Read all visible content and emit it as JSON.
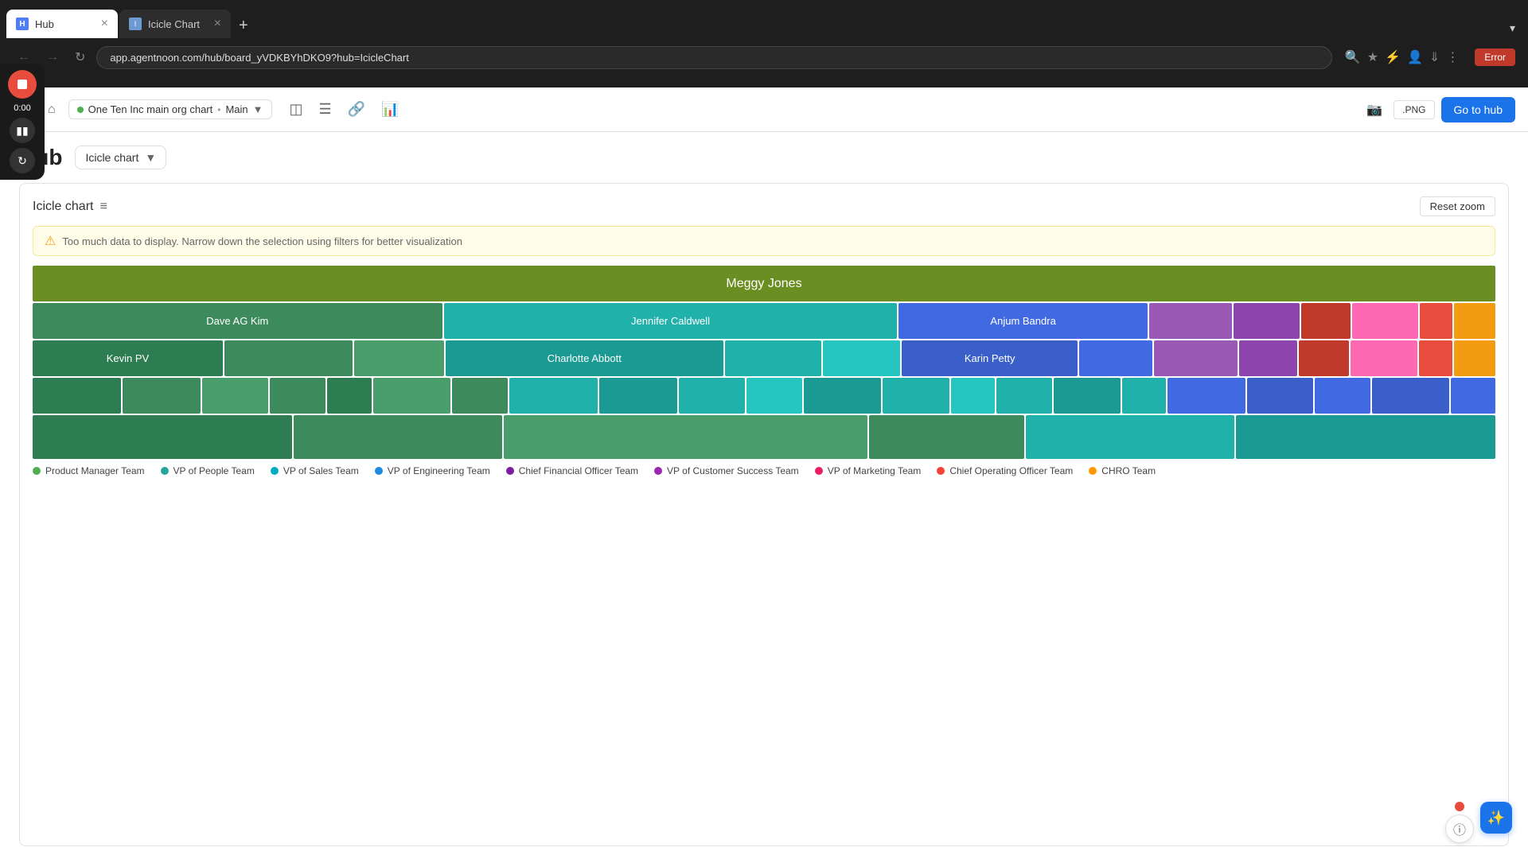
{
  "browser": {
    "tabs": [
      {
        "label": "Hub",
        "favicon_type": "hub",
        "active": true
      },
      {
        "label": "Icicle Chart",
        "favicon_type": "icicle",
        "active": false
      }
    ],
    "url": "app.agentnoon.com/hub/board_yVDKBYhDKO9?hub=IcicleChart",
    "new_tab_label": "+",
    "tab_dropdown_label": "▾",
    "error_button_label": "Error"
  },
  "toolbar": {
    "breadcrumb_org": "One Ten Inc main org chart",
    "breadcrumb_separator": "•",
    "breadcrumb_sub": "Main",
    "png_label": ".PNG",
    "go_to_hub_label": "Go to hub"
  },
  "hub": {
    "title": "Hub",
    "chart_type_label": "Icicle chart"
  },
  "chart": {
    "title": "Icicle chart",
    "warning": "Too much data to display. Narrow down the selection using filters for better visualization",
    "reset_zoom_label": "Reset zoom",
    "root_node": "Meggy Jones",
    "level2": {
      "dave": "Dave AG Kim",
      "jennifer": "Jennifer Caldwell",
      "anjum": "Anjum Bandra"
    },
    "level3": {
      "kevin": "Kevin PV",
      "charlotte": "Charlotte Abbott",
      "karin": "Karin Petty"
    }
  },
  "recording": {
    "time": "0:00"
  },
  "legend": [
    {
      "color": "#4CAF50",
      "label": "Product Manager Team"
    },
    {
      "color": "#26a69a",
      "label": "VP of People Team"
    },
    {
      "color": "#00acc1",
      "label": "VP of Sales Team"
    },
    {
      "color": "#1e88e5",
      "label": "VP of Engineering Team"
    },
    {
      "color": "#7b1fa2",
      "label": "Chief Financial Officer Team"
    },
    {
      "color": "#9c27b0",
      "label": "VP of Customer Success Team"
    },
    {
      "color": "#e91e63",
      "label": "VP of Marketing Team"
    },
    {
      "color": "#f44336",
      "label": "Chief Operating Officer Team"
    },
    {
      "color": "#ff9800",
      "label": "CHRO Team"
    }
  ]
}
